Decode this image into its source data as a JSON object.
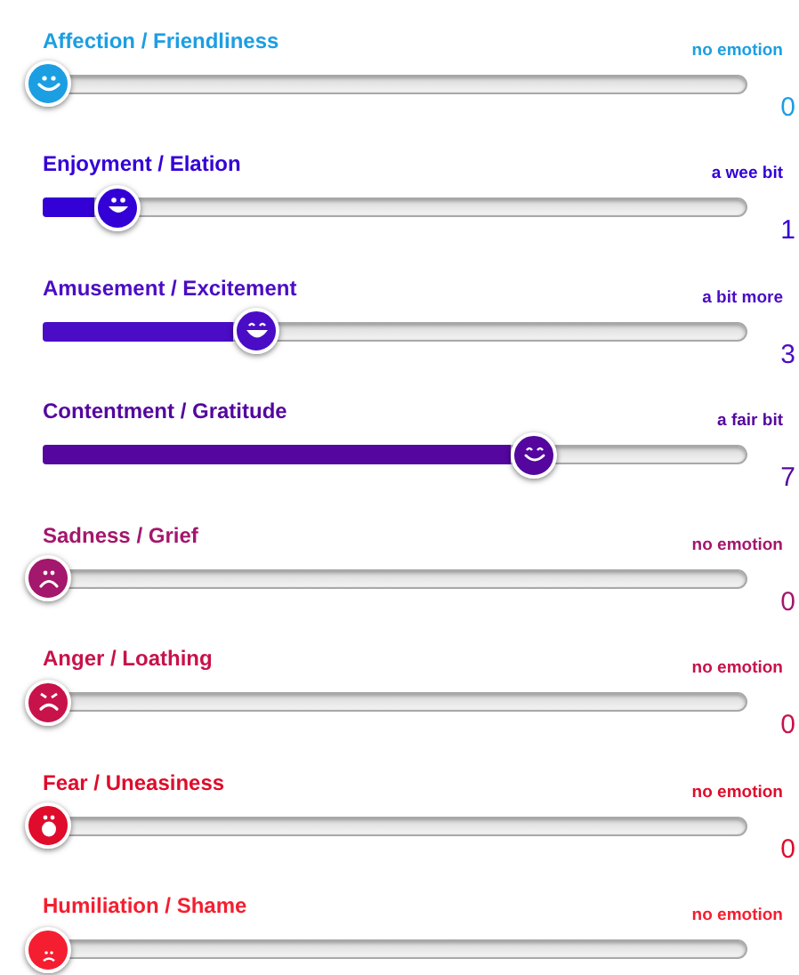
{
  "emotions": [
    {
      "label": "Affection / Friendliness",
      "intensity": "no emotion",
      "reading": "0",
      "level": 0,
      "color": "#1c9ee2",
      "kind": "smile"
    },
    {
      "label": "Enjoyment / Elation",
      "intensity": "a wee bit",
      "reading": "1",
      "level": 0.1,
      "color": "#3300d6",
      "kind": "grin"
    },
    {
      "label": "Amusement / Excitement",
      "intensity": "a bit more",
      "reading": "3",
      "level": 0.3,
      "color": "#4a0cc4",
      "kind": "laugh"
    },
    {
      "label": "Contentment / Gratitude",
      "intensity": "a fair bit",
      "reading": "7",
      "level": 0.7,
      "color": "#54069e",
      "kind": "content"
    },
    {
      "label": "Sadness / Grief",
      "intensity": "no emotion",
      "reading": "0",
      "level": 0,
      "color": "#a3176c",
      "kind": "sad"
    },
    {
      "label": "Anger / Loathing",
      "intensity": "no emotion",
      "reading": "0",
      "level": 0,
      "color": "#c8124a",
      "kind": "angry"
    },
    {
      "label": "Fear / Uneasiness",
      "intensity": "no emotion",
      "reading": "0",
      "level": 0,
      "color": "#df0c2c",
      "kind": "scared"
    },
    {
      "label": "Humiliation / Shame",
      "intensity": "no emotion",
      "level": 0,
      "color": "#f41e30",
      "kind": "ashamed"
    }
  ]
}
